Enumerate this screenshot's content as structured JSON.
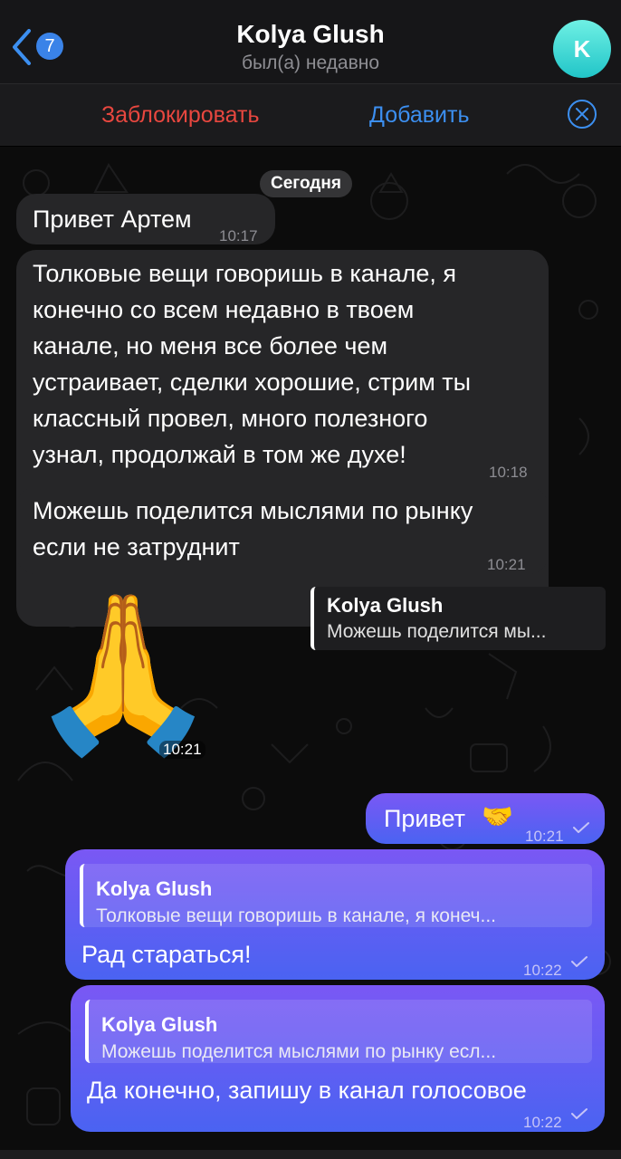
{
  "header": {
    "back_count": "7",
    "title": "Kolya Glush",
    "status": "был(а) недавно",
    "avatar_letter": "K"
  },
  "actions": {
    "block": "Заблокировать",
    "add": "Добавить"
  },
  "chat": {
    "day_label": "Сегодня",
    "messages": [
      {
        "direction": "in",
        "text": "Привет Артем",
        "time": "10:17"
      },
      {
        "direction": "in",
        "text": "Толковые вещи говоришь в канале, я\nконечно со всем недавно в твоем\nканале, но меня все более чем\nустраивает, сделки хорошие, стрим ты\nклассный провел, много полезного\nузнал, продолжай в том же духе!",
        "time": "10:18"
      },
      {
        "direction": "in",
        "text": "Можешь поделится мыслями по рынку\nесли не затруднит",
        "time": "10:21"
      },
      {
        "direction": "in",
        "type": "sticker",
        "emoji": "🙏",
        "time": "10:21",
        "reply": {
          "name": "Kolya Glush",
          "text": "Можешь поделится мы..."
        }
      },
      {
        "direction": "out",
        "text": "Привет",
        "emoji": "🤝",
        "time": "10:21"
      },
      {
        "direction": "out",
        "text": "Рад стараться!",
        "time": "10:22",
        "reply": {
          "name": "Kolya Glush",
          "text": "Толковые вещи говоришь в канале, я конеч..."
        }
      },
      {
        "direction": "out",
        "text": "Да конечно, запишу в канал голосовое",
        "time": "10:22",
        "reply": {
          "name": "Kolya Glush",
          "text": "Можешь поделится мыслями по рынку есл..."
        }
      }
    ]
  },
  "colors": {
    "accent": "#3c8ff0",
    "danger": "#e8473f",
    "outgoing": "#6a5cf3",
    "incoming": "#262628",
    "avatar": "#3fd9d8"
  }
}
